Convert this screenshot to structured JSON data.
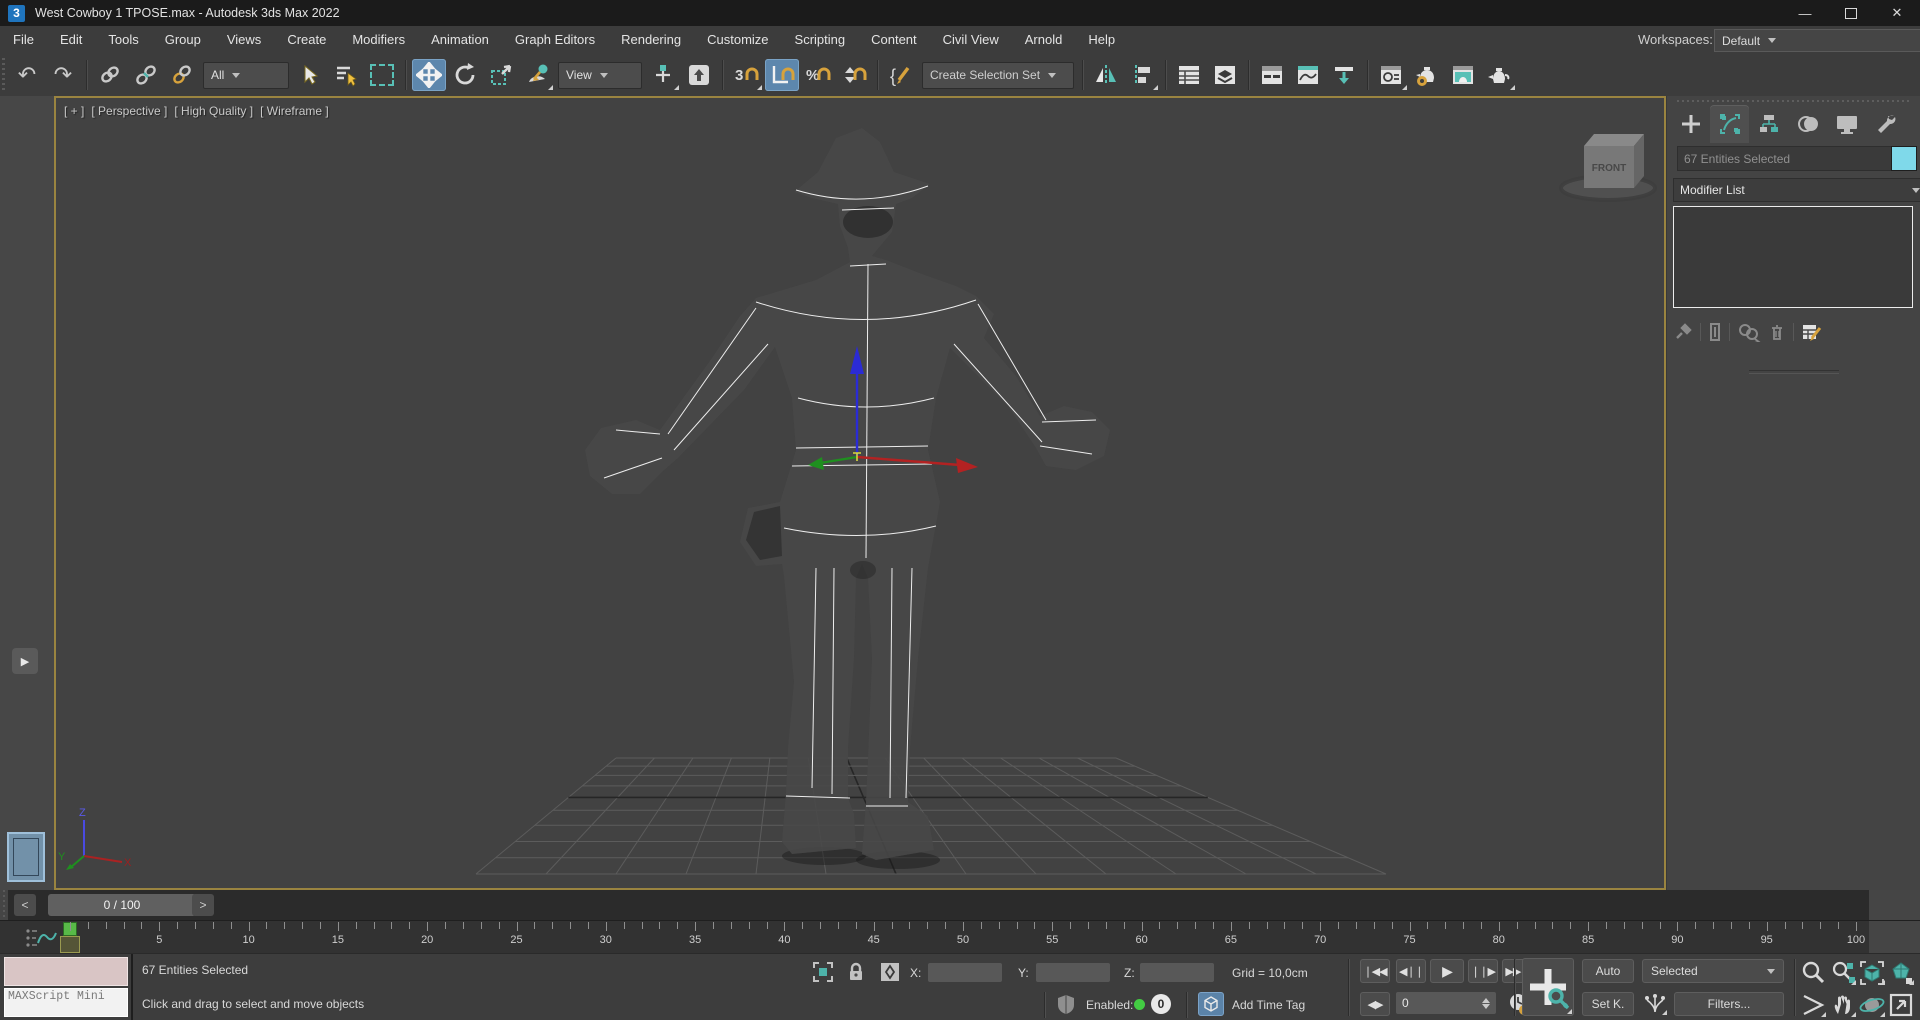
{
  "window": {
    "logo_text": "3",
    "title": "West Cowboy 1 TPOSE.max - Autodesk 3ds Max 2022",
    "minimize_glyph": "—",
    "close_glyph": "✕"
  },
  "menu_bar": {
    "items": [
      "File",
      "Edit",
      "Tools",
      "Group",
      "Views",
      "Create",
      "Modifiers",
      "Animation",
      "Graph Editors",
      "Rendering",
      "Customize",
      "Scripting",
      "Content",
      "Civil View",
      "Arnold",
      "Help"
    ],
    "workspaces_label": "Workspaces:",
    "workspace_value": "Default"
  },
  "toolbar": {
    "selection_filter_value": "All",
    "reference_coordsys_value": "View",
    "named_selection_sets_placeholder": "Create Selection Set"
  },
  "viewport": {
    "label_segments": [
      "[ + ]",
      "[ Perspective ]",
      "[ High Quality ]",
      "[ Wireframe ]"
    ],
    "viewcube_front_label": "FRONT",
    "axis_x_label": "X",
    "axis_y_label": "Y",
    "axis_z_label": "Z"
  },
  "command_panel": {
    "tabs": [
      "create",
      "modify",
      "hierarchy",
      "motion",
      "display",
      "utilities"
    ],
    "selected_tab": "modify",
    "object_name_placeholder": "67 Entities Selected",
    "object_color": "#7fd9ea",
    "modifier_list_label": "Modifier List"
  },
  "timeline": {
    "slider_value": "0 / 100",
    "prev_glyph": "<",
    "next_glyph": ">",
    "current_frame": 0,
    "frame_start": 0,
    "frame_end": 100,
    "ruler_label_step": 5
  },
  "status_bar": {
    "maxscript_label": "MAXScript Mini",
    "selection_status": "67 Entities Selected",
    "prompt": "Click and drag to select and move objects",
    "x_label": "X:",
    "y_label": "Y:",
    "z_label": "Z:",
    "x_value": "",
    "y_value": "",
    "z_value": "",
    "grid_readout": "Grid = 10,0cm",
    "enabled_label": "Enabled:",
    "zero_badge": "0",
    "add_time_tag_label": "Add Time Tag",
    "frame_spinner_value": "0",
    "auto_key_label": "Auto",
    "set_key_label": "Set K.",
    "selected_dropdown_value": "Selected",
    "key_filters_label": "Filters..."
  },
  "colors": {
    "active_tool_blue": "#5d87ad",
    "teal_accent": "#4db3aa",
    "gold_accent": "#d7a23c",
    "viewport_border": "#9a8440",
    "selection_cyan": "#7fe9f2",
    "object_swatch_cyan": "#7fd9ea",
    "autokey_green": "#43cc43",
    "playhead_green": "#58b948",
    "maxscript_pink": "#d9c5c5"
  }
}
